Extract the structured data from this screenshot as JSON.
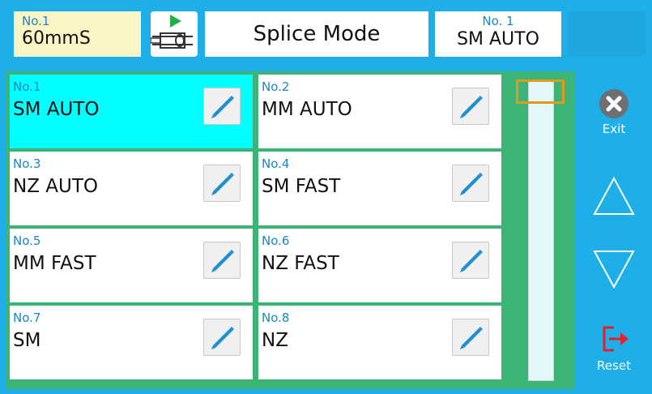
{
  "header": {
    "heat_no": "No.1",
    "heat_program": "60mmS",
    "title": "Splice Mode",
    "mode_no": "No. 1",
    "mode_name": "SM AUTO"
  },
  "modes": [
    {
      "no": "No.1",
      "name": "SM AUTO",
      "selected": true
    },
    {
      "no": "No.2",
      "name": "MM AUTO",
      "selected": false
    },
    {
      "no": "No.3",
      "name": "NZ AUTO",
      "selected": false
    },
    {
      "no": "No.4",
      "name": "SM FAST",
      "selected": false
    },
    {
      "no": "No.5",
      "name": "MM FAST",
      "selected": false
    },
    {
      "no": "No.6",
      "name": "NZ FAST",
      "selected": false
    },
    {
      "no": "No.7",
      "name": "SM",
      "selected": false
    },
    {
      "no": "No.8",
      "name": "NZ",
      "selected": false
    }
  ],
  "side": {
    "exit_label": "Exit",
    "reset_label": "Reset"
  },
  "colors": {
    "background": "#1eaee8",
    "grid_green": "#3cb476",
    "selected_cell": "#00ffff",
    "number_blue": "#1a87c4",
    "scroll_thumb": "#e29a1e",
    "reset_red": "#e4202a"
  },
  "icons": {
    "heater": "heater-icon",
    "edit": "pencil-icon",
    "exit": "close-circle-icon",
    "up": "triangle-up-icon",
    "down": "triangle-down-icon",
    "reset": "reset-exit-icon"
  }
}
